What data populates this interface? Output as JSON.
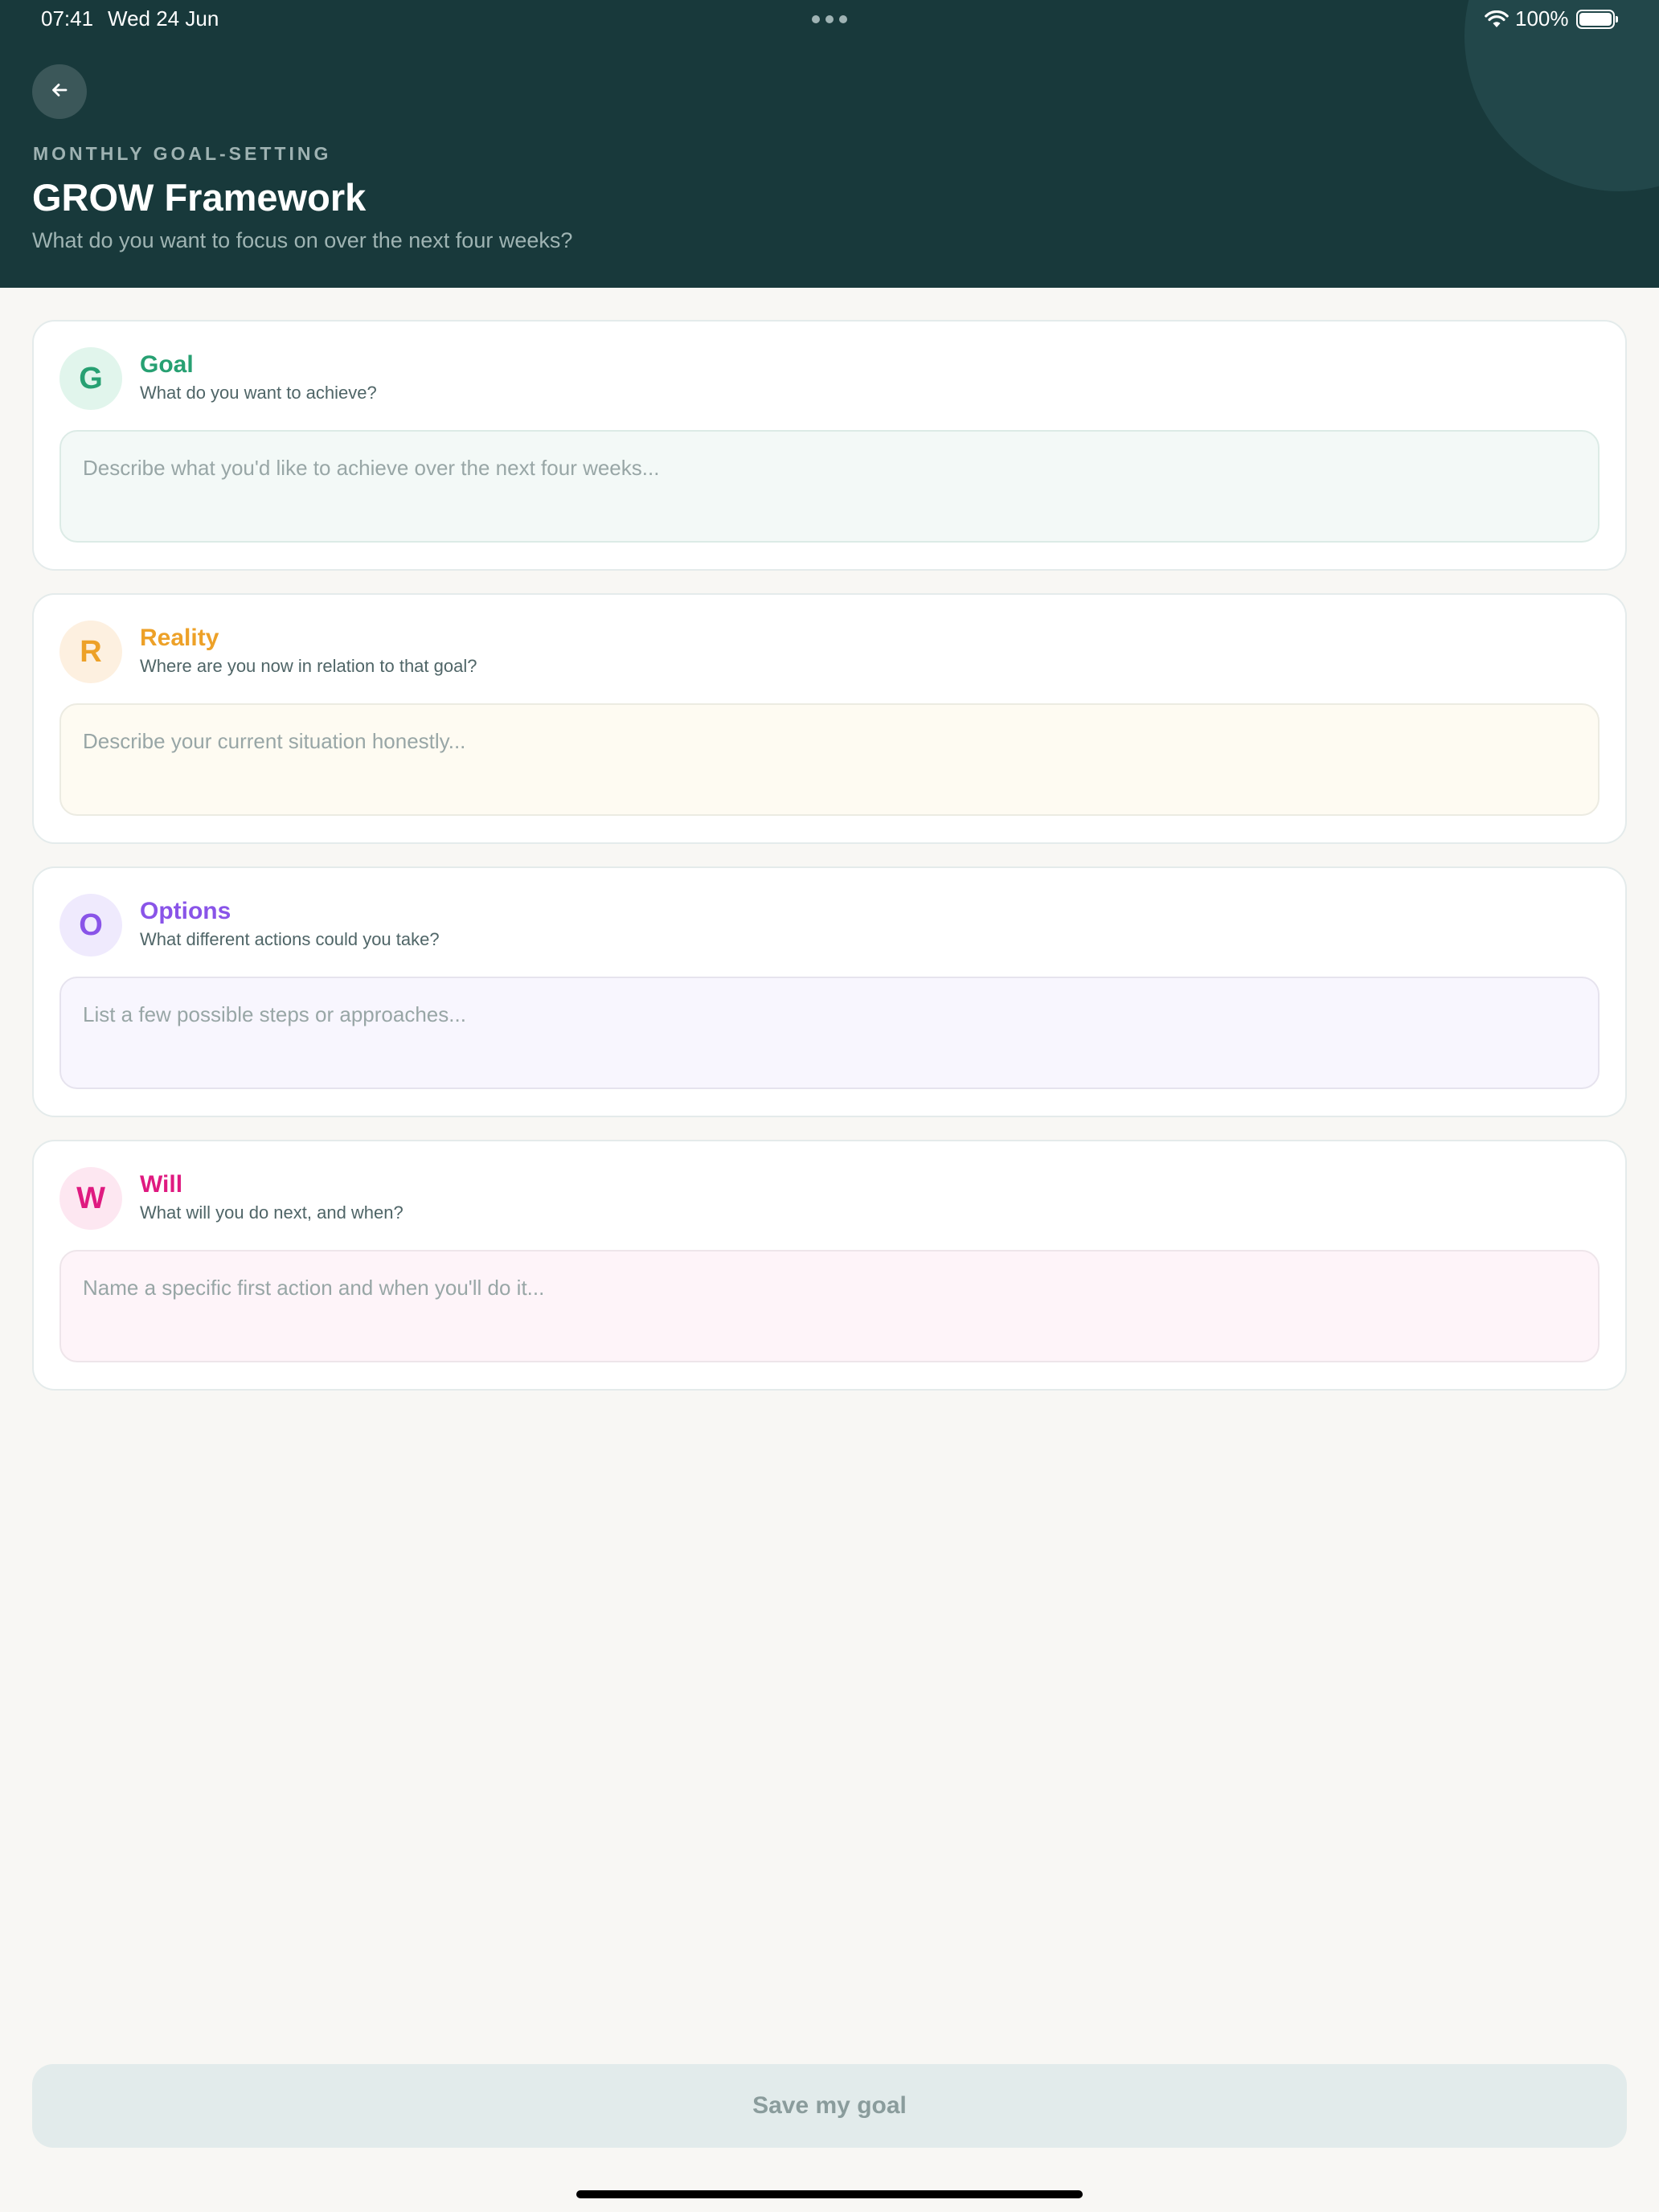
{
  "status_bar": {
    "time": "07:41",
    "date": "Wed 24 Jun",
    "battery": "100%"
  },
  "header": {
    "eyebrow": "MONTHLY GOAL-SETTING",
    "title": "GROW Framework",
    "subtitle": "What do you want to focus on over the next four weeks?",
    "back_icon": "arrow-left-icon"
  },
  "cards": [
    {
      "letter": "G",
      "title": "Goal",
      "description": "What do you want to achieve?",
      "placeholder": "Describe what you'd like to achieve over the next four weeks...",
      "value": "",
      "accent": "#27a072"
    },
    {
      "letter": "R",
      "title": "Reality",
      "description": "Where are you now in relation to that goal?",
      "placeholder": "Describe your current situation honestly...",
      "value": "",
      "accent": "#eda128"
    },
    {
      "letter": "O",
      "title": "Options",
      "description": "What different actions could you take?",
      "placeholder": "List a few possible steps or approaches...",
      "value": "",
      "accent": "#8954e8"
    },
    {
      "letter": "W",
      "title": "Will",
      "description": "What will you do next, and when?",
      "placeholder": "Name a specific first action and when you'll do it...",
      "value": "",
      "accent": "#df1a80"
    }
  ],
  "save_button": {
    "label": "Save my goal",
    "enabled": false
  },
  "colors": {
    "header_bg": "#18393b",
    "page_bg": "#f8f7f4"
  }
}
